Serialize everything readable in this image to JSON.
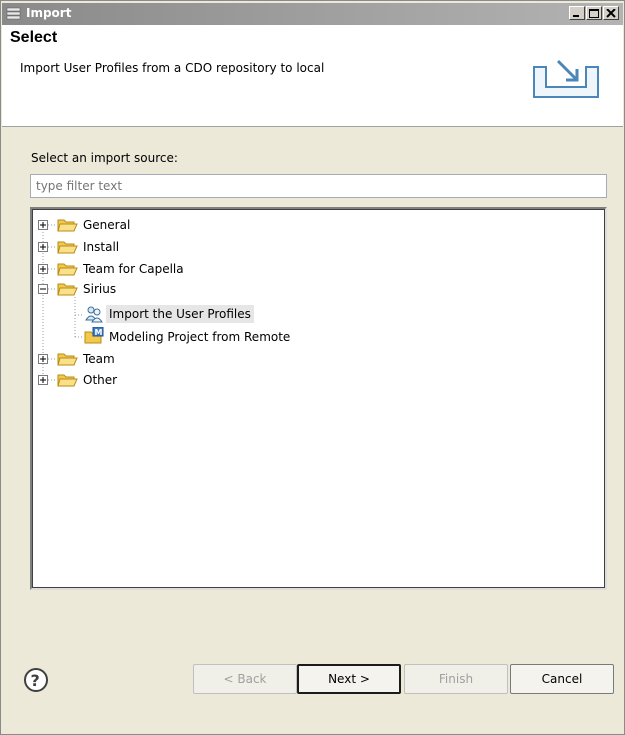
{
  "window": {
    "title": "Import"
  },
  "banner": {
    "title": "Select",
    "description": "Import User Profiles from a CDO repository to local"
  },
  "source_label": "Select an import source:",
  "filter": {
    "placeholder": "type filter text",
    "value": ""
  },
  "tree": [
    {
      "label": "General",
      "expander": "+"
    },
    {
      "label": "Install",
      "expander": "+"
    },
    {
      "label": "Team for Capella",
      "expander": "+"
    },
    {
      "label": "Sirius",
      "expander": "-",
      "children": [
        {
          "label": "Import the User Profiles",
          "selected": true,
          "icon": "users-icon"
        },
        {
          "label": "Modeling Project from Remote",
          "icon": "modeling-project-icon"
        }
      ]
    },
    {
      "label": "Team",
      "expander": "+"
    },
    {
      "label": "Other",
      "expander": "+"
    }
  ],
  "buttons": {
    "back": "< Back",
    "next": "Next >",
    "finish": "Finish",
    "cancel": "Cancel"
  },
  "colors": {
    "titlebar": "#8a8a8a",
    "folder": "#f2c94c",
    "selection": "#e6e6e6"
  }
}
